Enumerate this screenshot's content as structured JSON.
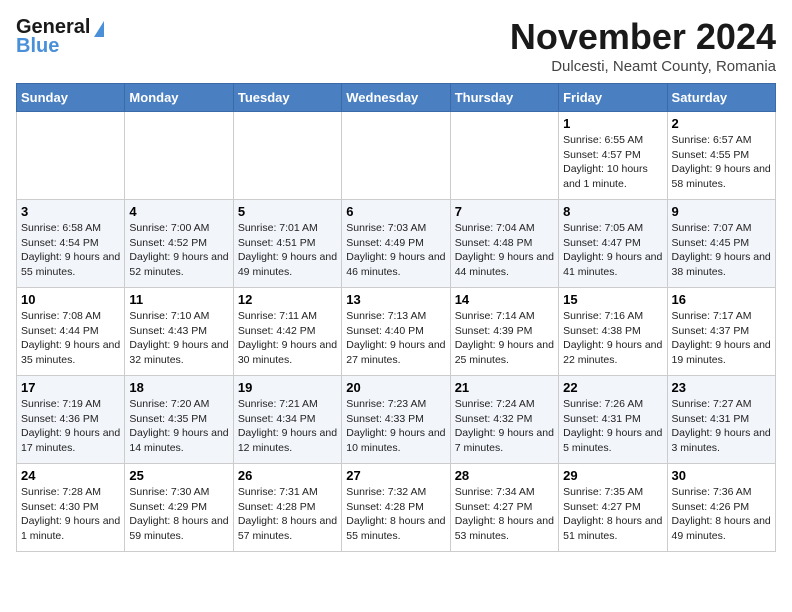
{
  "header": {
    "logo_general": "General",
    "logo_blue": "Blue",
    "month_title": "November 2024",
    "location": "Dulcesti, Neamt County, Romania"
  },
  "weekdays": [
    "Sunday",
    "Monday",
    "Tuesday",
    "Wednesday",
    "Thursday",
    "Friday",
    "Saturday"
  ],
  "weeks": [
    [
      {
        "day": "",
        "info": ""
      },
      {
        "day": "",
        "info": ""
      },
      {
        "day": "",
        "info": ""
      },
      {
        "day": "",
        "info": ""
      },
      {
        "day": "",
        "info": ""
      },
      {
        "day": "1",
        "info": "Sunrise: 6:55 AM\nSunset: 4:57 PM\nDaylight: 10 hours and 1 minute."
      },
      {
        "day": "2",
        "info": "Sunrise: 6:57 AM\nSunset: 4:55 PM\nDaylight: 9 hours and 58 minutes."
      }
    ],
    [
      {
        "day": "3",
        "info": "Sunrise: 6:58 AM\nSunset: 4:54 PM\nDaylight: 9 hours and 55 minutes."
      },
      {
        "day": "4",
        "info": "Sunrise: 7:00 AM\nSunset: 4:52 PM\nDaylight: 9 hours and 52 minutes."
      },
      {
        "day": "5",
        "info": "Sunrise: 7:01 AM\nSunset: 4:51 PM\nDaylight: 9 hours and 49 minutes."
      },
      {
        "day": "6",
        "info": "Sunrise: 7:03 AM\nSunset: 4:49 PM\nDaylight: 9 hours and 46 minutes."
      },
      {
        "day": "7",
        "info": "Sunrise: 7:04 AM\nSunset: 4:48 PM\nDaylight: 9 hours and 44 minutes."
      },
      {
        "day": "8",
        "info": "Sunrise: 7:05 AM\nSunset: 4:47 PM\nDaylight: 9 hours and 41 minutes."
      },
      {
        "day": "9",
        "info": "Sunrise: 7:07 AM\nSunset: 4:45 PM\nDaylight: 9 hours and 38 minutes."
      }
    ],
    [
      {
        "day": "10",
        "info": "Sunrise: 7:08 AM\nSunset: 4:44 PM\nDaylight: 9 hours and 35 minutes."
      },
      {
        "day": "11",
        "info": "Sunrise: 7:10 AM\nSunset: 4:43 PM\nDaylight: 9 hours and 32 minutes."
      },
      {
        "day": "12",
        "info": "Sunrise: 7:11 AM\nSunset: 4:42 PM\nDaylight: 9 hours and 30 minutes."
      },
      {
        "day": "13",
        "info": "Sunrise: 7:13 AM\nSunset: 4:40 PM\nDaylight: 9 hours and 27 minutes."
      },
      {
        "day": "14",
        "info": "Sunrise: 7:14 AM\nSunset: 4:39 PM\nDaylight: 9 hours and 25 minutes."
      },
      {
        "day": "15",
        "info": "Sunrise: 7:16 AM\nSunset: 4:38 PM\nDaylight: 9 hours and 22 minutes."
      },
      {
        "day": "16",
        "info": "Sunrise: 7:17 AM\nSunset: 4:37 PM\nDaylight: 9 hours and 19 minutes."
      }
    ],
    [
      {
        "day": "17",
        "info": "Sunrise: 7:19 AM\nSunset: 4:36 PM\nDaylight: 9 hours and 17 minutes."
      },
      {
        "day": "18",
        "info": "Sunrise: 7:20 AM\nSunset: 4:35 PM\nDaylight: 9 hours and 14 minutes."
      },
      {
        "day": "19",
        "info": "Sunrise: 7:21 AM\nSunset: 4:34 PM\nDaylight: 9 hours and 12 minutes."
      },
      {
        "day": "20",
        "info": "Sunrise: 7:23 AM\nSunset: 4:33 PM\nDaylight: 9 hours and 10 minutes."
      },
      {
        "day": "21",
        "info": "Sunrise: 7:24 AM\nSunset: 4:32 PM\nDaylight: 9 hours and 7 minutes."
      },
      {
        "day": "22",
        "info": "Sunrise: 7:26 AM\nSunset: 4:31 PM\nDaylight: 9 hours and 5 minutes."
      },
      {
        "day": "23",
        "info": "Sunrise: 7:27 AM\nSunset: 4:31 PM\nDaylight: 9 hours and 3 minutes."
      }
    ],
    [
      {
        "day": "24",
        "info": "Sunrise: 7:28 AM\nSunset: 4:30 PM\nDaylight: 9 hours and 1 minute."
      },
      {
        "day": "25",
        "info": "Sunrise: 7:30 AM\nSunset: 4:29 PM\nDaylight: 8 hours and 59 minutes."
      },
      {
        "day": "26",
        "info": "Sunrise: 7:31 AM\nSunset: 4:28 PM\nDaylight: 8 hours and 57 minutes."
      },
      {
        "day": "27",
        "info": "Sunrise: 7:32 AM\nSunset: 4:28 PM\nDaylight: 8 hours and 55 minutes."
      },
      {
        "day": "28",
        "info": "Sunrise: 7:34 AM\nSunset: 4:27 PM\nDaylight: 8 hours and 53 minutes."
      },
      {
        "day": "29",
        "info": "Sunrise: 7:35 AM\nSunset: 4:27 PM\nDaylight: 8 hours and 51 minutes."
      },
      {
        "day": "30",
        "info": "Sunrise: 7:36 AM\nSunset: 4:26 PM\nDaylight: 8 hours and 49 minutes."
      }
    ]
  ]
}
